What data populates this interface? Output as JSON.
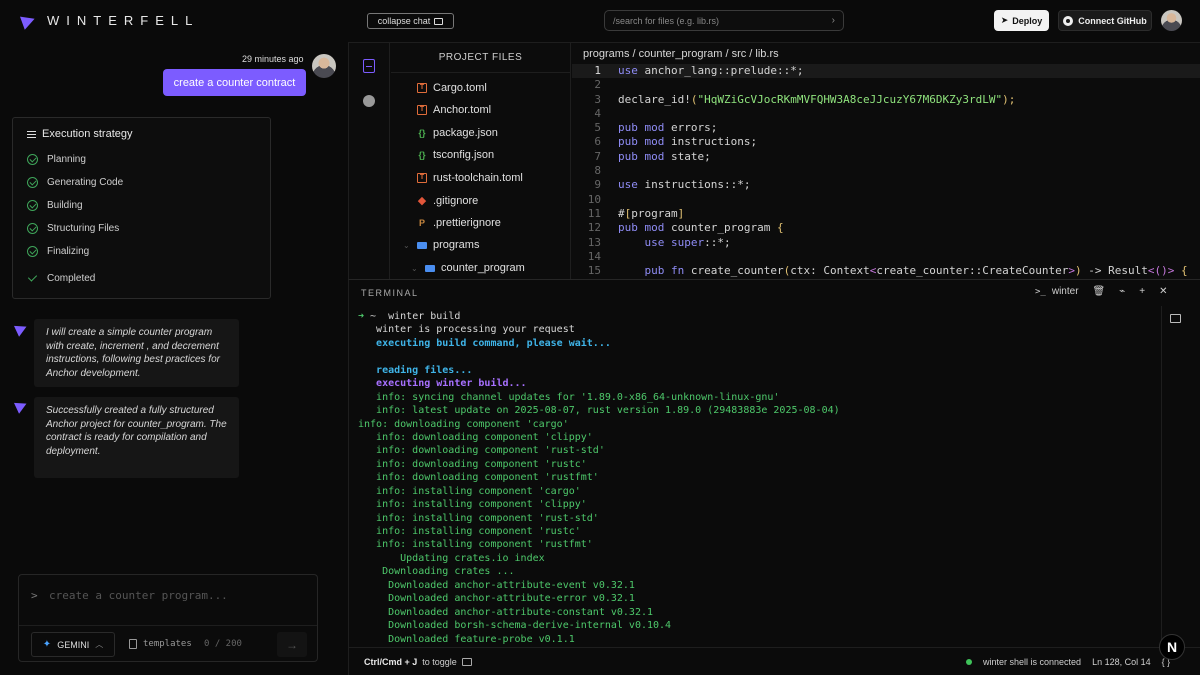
{
  "app": {
    "name": "WINTERFELL",
    "collapse_chat_label": "collapse chat",
    "search_placeholder": "/search for files (e.g. lib.rs)",
    "deploy_label": "Deploy",
    "github_label": "Connect GitHub"
  },
  "chat": {
    "user_message": {
      "time": "29 minutes ago",
      "text": "create a counter contract"
    },
    "execution": {
      "title": "Execution strategy",
      "steps": [
        "Planning",
        "Generating Code",
        "Building",
        "Structuring Files",
        "Finalizing"
      ],
      "completed_label": "Completed"
    },
    "bot_messages": [
      "I will create a simple counter program with create, increment , and decrement instructions, following best practices for Anchor development.",
      "Successfully created a fully structured Anchor project for counter_program. The contract is ready for compilation and deployment."
    ],
    "prompt": {
      "prompt_symbol": ">",
      "placeholder": "create a counter program...",
      "model": "GEMINI",
      "templates_label": "templates",
      "char_count": "0 / 200"
    }
  },
  "explorer": {
    "title": "PROJECT FILES",
    "files": [
      {
        "name": "Cargo.toml",
        "type": "toml"
      },
      {
        "name": "Anchor.toml",
        "type": "toml"
      },
      {
        "name": "package.json",
        "type": "json"
      },
      {
        "name": "tsconfig.json",
        "type": "json"
      },
      {
        "name": "rust-toolchain.toml",
        "type": "toml"
      },
      {
        "name": ".gitignore",
        "type": "git"
      },
      {
        "name": ".prettierignore",
        "type": "prettier"
      },
      {
        "name": "programs",
        "type": "folder"
      },
      {
        "name": "counter_program",
        "type": "folder"
      }
    ]
  },
  "editor": {
    "breadcrumb": "programs / counter_program / src / lib.rs",
    "line_numbers": [
      "1",
      "2",
      "3",
      "4",
      "5",
      "6",
      "7",
      "8",
      "9",
      "10",
      "11",
      "12",
      "13",
      "14",
      "15"
    ],
    "cursor_line": "1",
    "code": {
      "l1_kw": "use",
      "l1_rest": " anchor_lang::prelude::*;",
      "l3_mac": "declare_id!",
      "l3_open": "(",
      "l3_str": "\"HqWZiGcVJocRKmMVFQHW3A8ceJJcuzY67M6DKZy3rdLW\"",
      "l3_close": ");",
      "l5_kw": "pub mod",
      "l5_rest": " errors;",
      "l6_kw": "pub mod",
      "l6_rest": " instructions;",
      "l7_kw": "pub mod",
      "l7_rest": " state;",
      "l9_kw": "use",
      "l9_rest": " instructions::*;",
      "l11_hash": "#",
      "l11_open": "[",
      "l11_attr": "program",
      "l11_close": "]",
      "l12_kw": "pub mod",
      "l12_rest": " counter_program ",
      "l12_brace": "{",
      "l13_indent": "    ",
      "l13_kw": "use super",
      "l13_rest": "::*;",
      "l15_indent": "    ",
      "l15_kw": "pub fn",
      "l15_rest": " create_counter",
      "l15_p1": "(",
      "l15_args": "ctx: Context",
      "l15_lt": "<",
      "l15_type": "create_counter::CreateCounter",
      "l15_gt": ">",
      "l15_p2": ")",
      "l15_ret": " -> Result",
      "l15_lt2": "<",
      "l15_unit": "()",
      "l15_gt2": ">",
      "l15_brace": " {"
    }
  },
  "terminal": {
    "title": "TERMINAL",
    "shell_label": "winter",
    "prompt_arrow": "➜",
    "prompt_path": " ~  ",
    "command": "winter build",
    "lines": [
      {
        "text": "   winter is processing your request",
        "style": "white"
      },
      {
        "text": "   executing build command, please wait...",
        "style": "cyan"
      },
      {
        "text": "",
        "style": "white"
      },
      {
        "text": "   reading files...",
        "style": "cyan"
      },
      {
        "text": "   executing winter build...",
        "style": "purple"
      },
      {
        "text": "   info: syncing channel updates for '1.89.0-x86_64-unknown-linux-gnu'",
        "style": "green"
      },
      {
        "text": "   info: latest update on 2025-08-07, rust version 1.89.0 (29483883e 2025-08-04)",
        "style": "green"
      },
      {
        "text": "info: downloading component 'cargo'",
        "style": "green"
      },
      {
        "text": "   info: downloading component 'clippy'",
        "style": "green"
      },
      {
        "text": "   info: downloading component 'rust-std'",
        "style": "green"
      },
      {
        "text": "   info: downloading component 'rustc'",
        "style": "green"
      },
      {
        "text": "   info: downloading component 'rustfmt'",
        "style": "green"
      },
      {
        "text": "   info: installing component 'cargo'",
        "style": "green"
      },
      {
        "text": "   info: installing component 'clippy'",
        "style": "green"
      },
      {
        "text": "   info: installing component 'rust-std'",
        "style": "green"
      },
      {
        "text": "   info: installing component 'rustc'",
        "style": "green"
      },
      {
        "text": "   info: installing component 'rustfmt'",
        "style": "green"
      },
      {
        "text": "       Updating crates.io index",
        "style": "green"
      },
      {
        "text": "    Downloading crates ...",
        "style": "green"
      },
      {
        "text": "     Downloaded anchor-attribute-event v0.32.1",
        "style": "green"
      },
      {
        "text": "     Downloaded anchor-attribute-error v0.32.1",
        "style": "green"
      },
      {
        "text": "     Downloaded anchor-attribute-constant v0.32.1",
        "style": "green"
      },
      {
        "text": "     Downloaded borsh-schema-derive-internal v0.10.4",
        "style": "green"
      },
      {
        "text": "     Downloaded feature-probe v0.1.1",
        "style": "green"
      }
    ],
    "footer": {
      "shortcut": "Ctrl/Cmd + J",
      "toggle_label": "to toggle",
      "status": "winter shell is connected",
      "position": "Ln 128, Col 14",
      "braces": "{ }"
    }
  },
  "badge": "N",
  "colors": {
    "accent": "#7c5cff",
    "success": "#3fa55a",
    "terminal_green": "#4ec96b"
  }
}
